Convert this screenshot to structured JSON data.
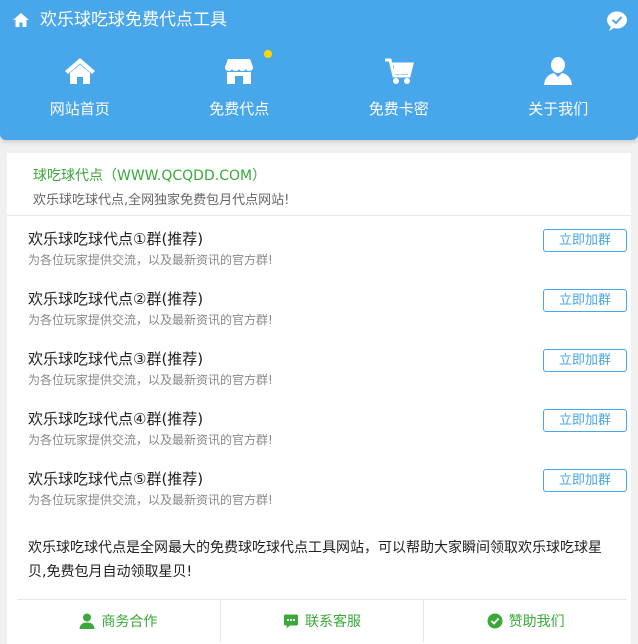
{
  "header": {
    "title": "欢乐球吃球免费代点工具",
    "brand_color": "#48a6ea",
    "icons": [
      "home-icon",
      "chat-bubble-icon"
    ]
  },
  "nav": [
    {
      "label": "网站首页",
      "icon": "home-icon"
    },
    {
      "label": "免费代点",
      "icon": "shop-icon",
      "badge_dot": true
    },
    {
      "label": "免费卡密",
      "icon": "cart-icon"
    },
    {
      "label": "关于我们",
      "icon": "user-icon"
    }
  ],
  "intro": {
    "name": "球吃球代点（WWW.QCQDD.COM）",
    "desc": "欢乐球吃球代点,全网独家免费包月代点网站!"
  },
  "groups": [
    {
      "title": "欢乐球吃球代点①群(推荐)",
      "desc": "为各位玩家提供交流，以及最新资讯的官方群!",
      "button": "立即加群"
    },
    {
      "title": "欢乐球吃球代点②群(推荐)",
      "desc": "为各位玩家提供交流，以及最新资讯的官方群!",
      "button": "立即加群"
    },
    {
      "title": "欢乐球吃球代点③群(推荐)",
      "desc": "为各位玩家提供交流，以及最新资讯的官方群!",
      "button": "立即加群"
    },
    {
      "title": "欢乐球吃球代点④群(推荐)",
      "desc": "为各位玩家提供交流，以及最新资讯的官方群!",
      "button": "立即加群"
    },
    {
      "title": "欢乐球吃球代点⑤群(推荐)",
      "desc": "为各位玩家提供交流，以及最新资讯的官方群!",
      "button": "立即加群"
    }
  ],
  "about": "欢乐球吃球代点是全网最大的免费球吃球代点工具网站，可以帮助大家瞬间领取欢乐球吃球星贝,免费包月自动领取星贝!",
  "footer": [
    {
      "label": "商务合作",
      "icon": "user-icon"
    },
    {
      "label": "联系客服",
      "icon": "message-icon"
    },
    {
      "label": "赞助我们",
      "icon": "check-circle-icon"
    }
  ],
  "colors": {
    "accent_green": "#3aa83a",
    "badge_yellow": "#ffd700"
  }
}
